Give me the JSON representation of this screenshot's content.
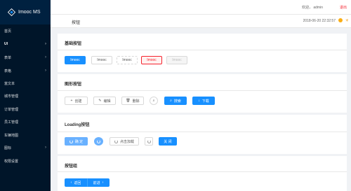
{
  "app": {
    "title": "Imooc MS"
  },
  "sidebar": {
    "items": [
      {
        "label": "首页",
        "arrow": ""
      },
      {
        "label": "UI",
        "arrow": "›"
      },
      {
        "label": "表单",
        "arrow": "›"
      },
      {
        "label": "表格",
        "arrow": "›"
      },
      {
        "label": "富文本",
        "arrow": ""
      },
      {
        "label": "城市管理",
        "arrow": ""
      },
      {
        "label": "订单管理",
        "arrow": ""
      },
      {
        "label": "员工管理",
        "arrow": ""
      },
      {
        "label": "车辆地图",
        "arrow": ""
      },
      {
        "label": "图标",
        "arrow": "›"
      },
      {
        "label": "权限设置",
        "arrow": ""
      }
    ]
  },
  "header": {
    "welcome": "欢迎， admin",
    "logout": "退出"
  },
  "breadcrumb": {
    "title": "按钮",
    "datetime": "2018-06-20 22:32:57",
    "weather_icon": "cloud-sun-icon"
  },
  "cards": {
    "basic": {
      "title": "基础按钮",
      "buttons": [
        "Imooc",
        "Imooc",
        "Imooc",
        "Imooc",
        "Imooc"
      ]
    },
    "shape": {
      "title": "图形按钮",
      "buttons": [
        "创建",
        "编辑",
        "删除",
        "",
        "搜索",
        "下载"
      ]
    },
    "loading": {
      "title": "Loading按钮",
      "buttons": [
        "确 定",
        "",
        "点击加载",
        "",
        "关 闭"
      ]
    },
    "group": {
      "title": "按钮组",
      "back": "返回",
      "forward": "前进"
    }
  },
  "colors": {
    "primary": "#1890ff",
    "sidebar_bg": "#001529",
    "danger": "#f5222d"
  }
}
